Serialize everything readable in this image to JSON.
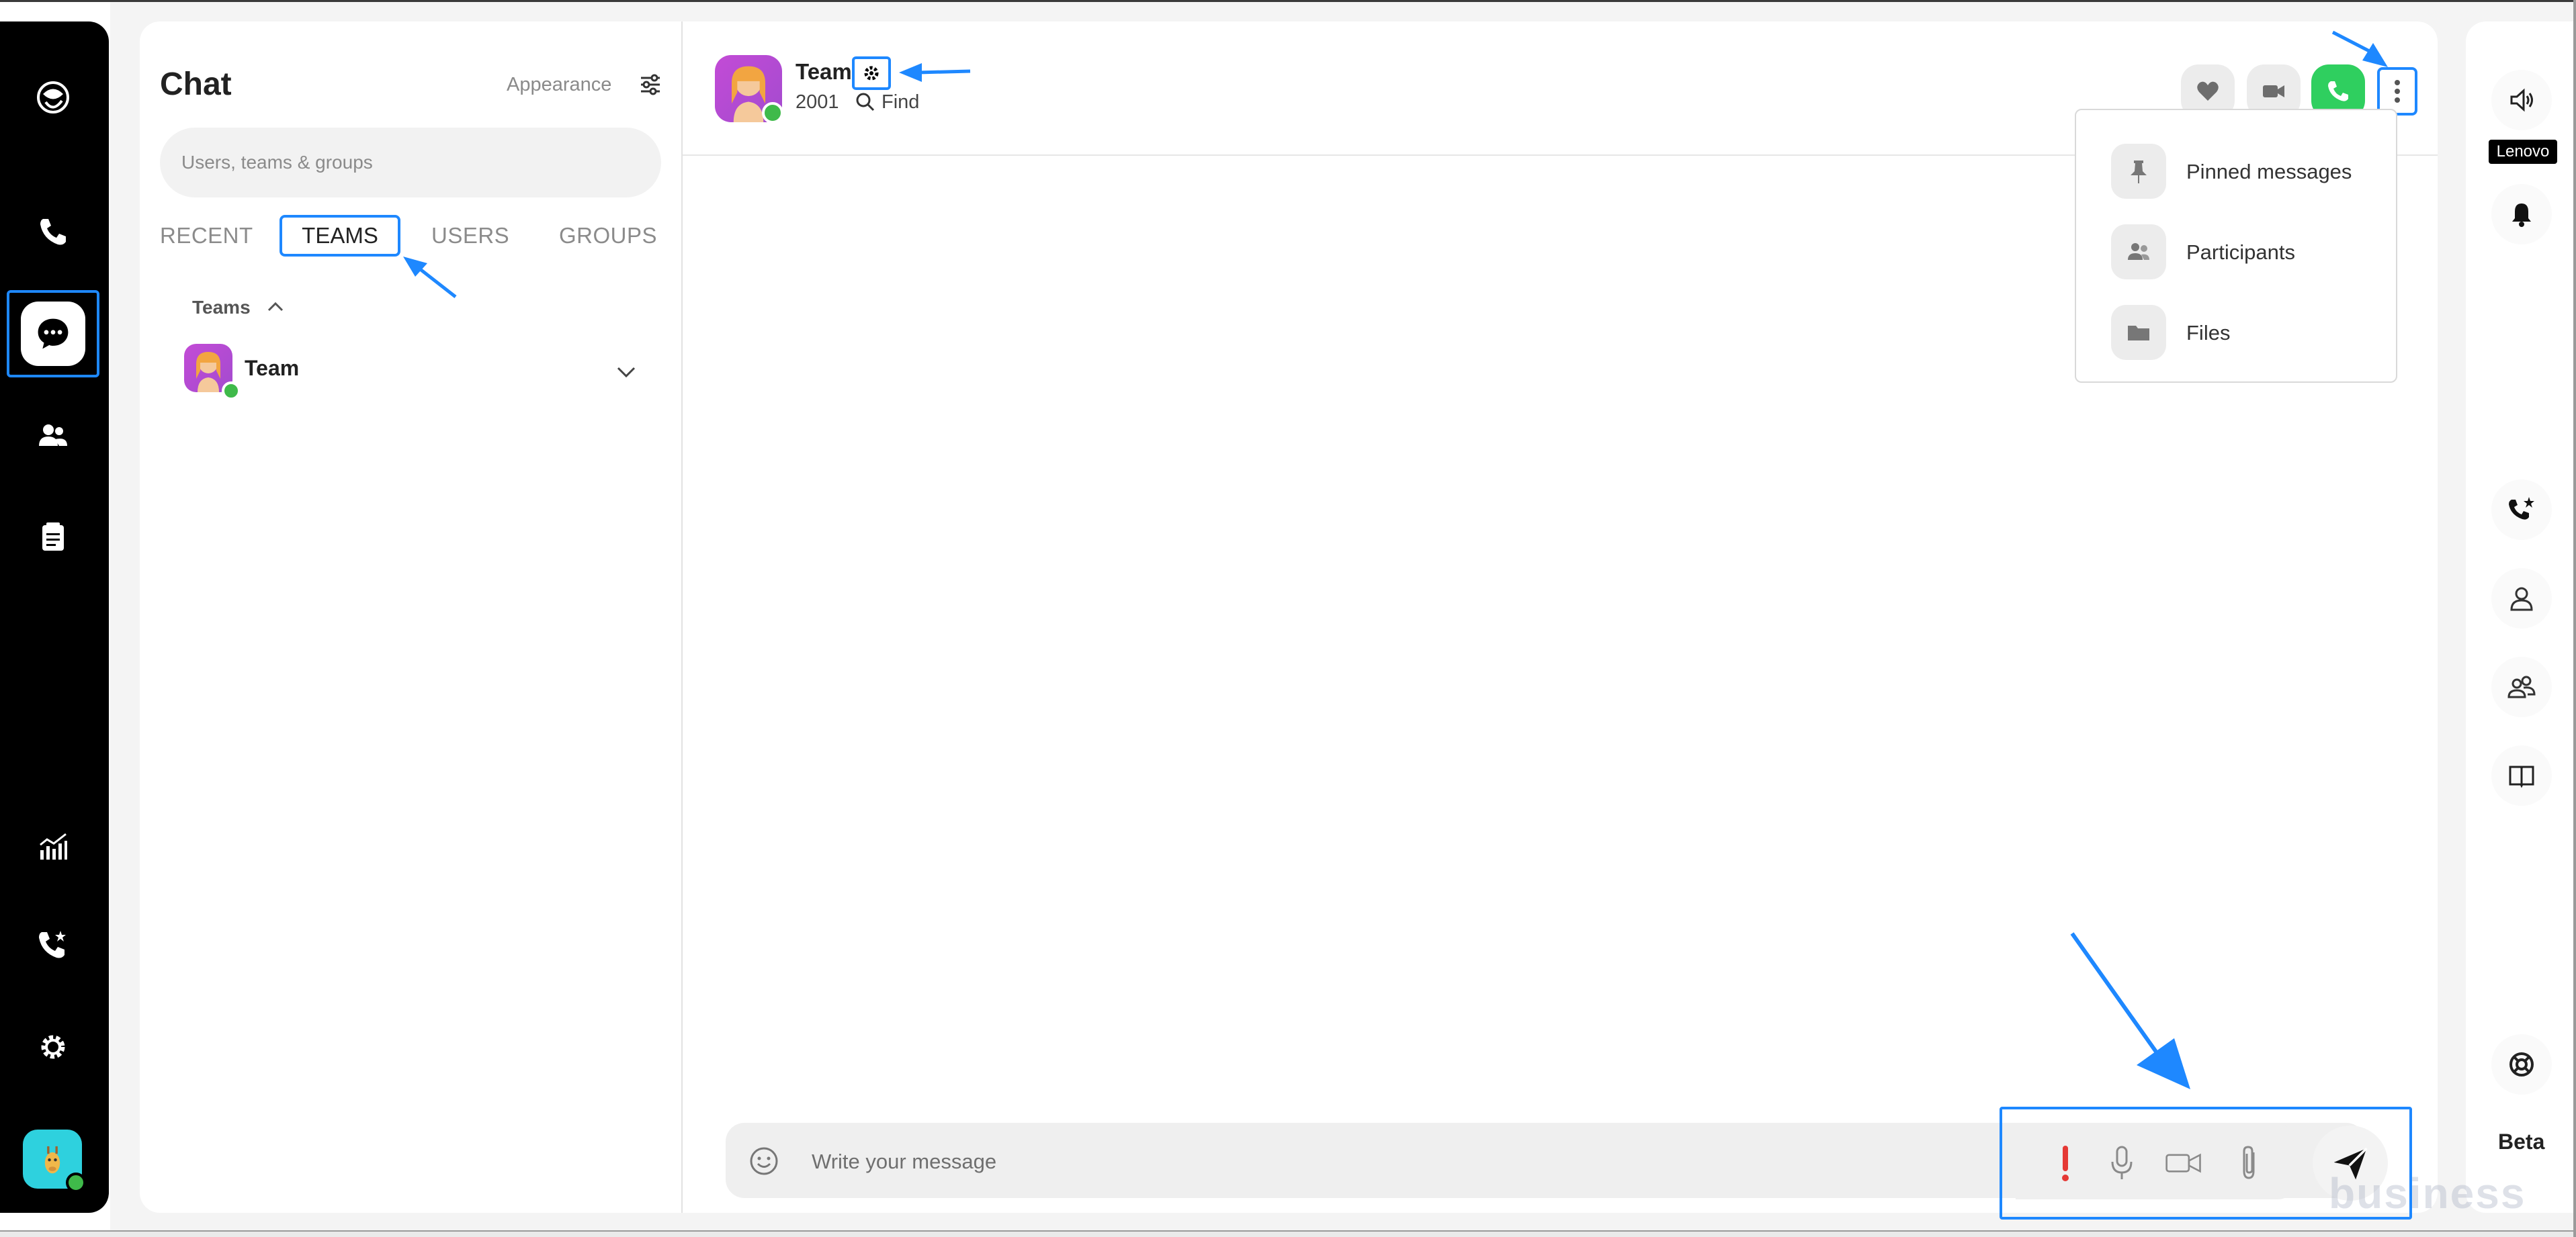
{
  "nav": {
    "items": [
      "logo",
      "calls",
      "chat",
      "contacts",
      "notes",
      "analytics",
      "call-settings",
      "settings",
      "avatar"
    ]
  },
  "chat_panel": {
    "title": "Chat",
    "appearance_label": "Appearance",
    "search_placeholder": "Users, teams & groups",
    "tabs": [
      "RECENT",
      "TEAMS",
      "USERS",
      "GROUPS"
    ],
    "active_tab": "TEAMS",
    "group_label": "Teams",
    "teams": [
      {
        "name": "Team"
      }
    ]
  },
  "conversation": {
    "title": "Team",
    "number": "2001",
    "find_label": "Find",
    "composer_placeholder": "Write your message",
    "menu": [
      {
        "label": "Pinned messages",
        "icon": "pin-icon"
      },
      {
        "label": "Participants",
        "icon": "participants-icon"
      },
      {
        "label": "Files",
        "icon": "folder-icon"
      }
    ]
  },
  "right_bar": {
    "device_label": "Lenovo",
    "beta_label": "Beta"
  },
  "watermark": "business",
  "colors": {
    "accent": "#1e88ff",
    "call_green": "#2fcf5f",
    "online": "#3fba4a",
    "urgent": "#e53935"
  }
}
